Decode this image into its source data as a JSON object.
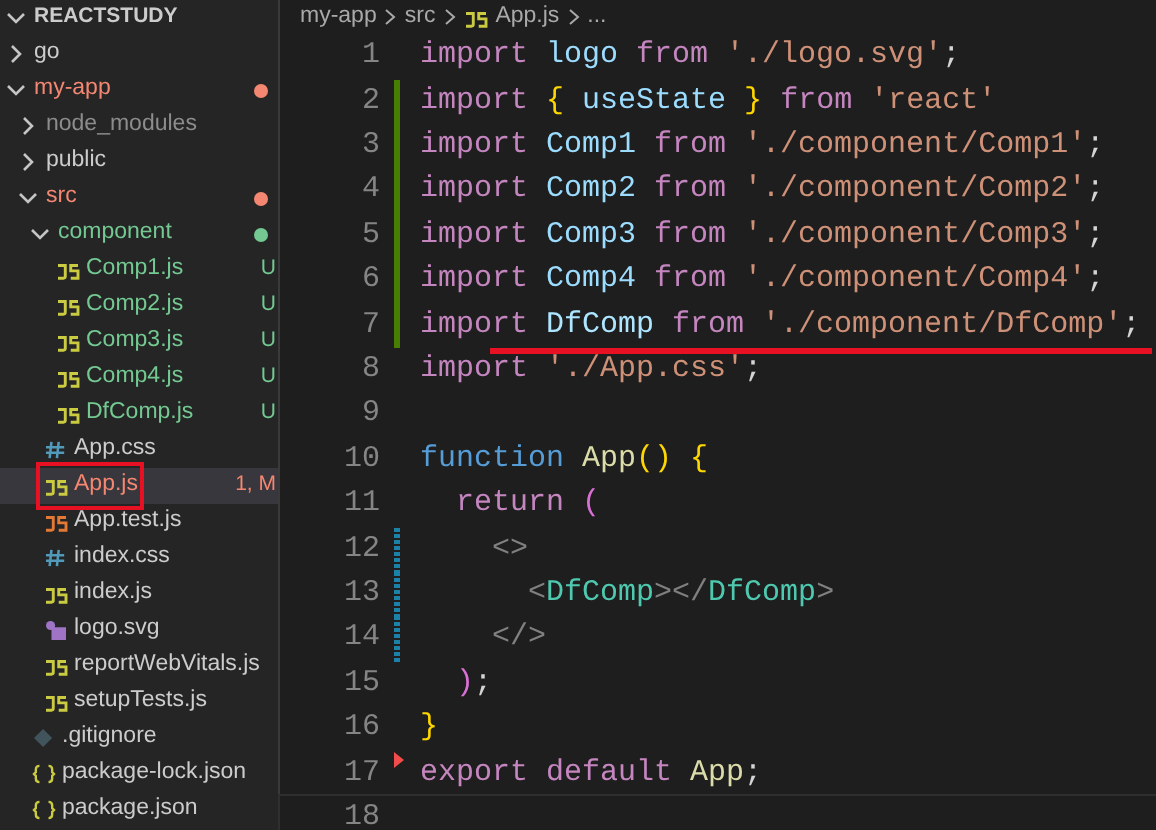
{
  "explorer": {
    "title": "REACTSTUDY",
    "expanded": true,
    "items": [
      {
        "label": "go",
        "kind": "folder",
        "expanded": false,
        "color": "#cccccc",
        "dot": false,
        "selected": false,
        "boxed": false
      },
      {
        "label": "my-app",
        "kind": "folder",
        "expanded": true,
        "color": "#f48771",
        "dot": true,
        "selected": false,
        "boxed": false,
        "children": [
          {
            "label": "node_modules",
            "kind": "folder",
            "expanded": false,
            "color": "#8c8c8c",
            "dot": false,
            "selected": false,
            "boxed": false
          },
          {
            "label": "public",
            "kind": "folder",
            "expanded": false,
            "color": "#cccccc",
            "dot": false,
            "selected": false,
            "boxed": false
          },
          {
            "label": "src",
            "kind": "folder",
            "expanded": true,
            "color": "#f48771",
            "dot": true,
            "selected": false,
            "boxed": false,
            "children": [
              {
                "label": "component",
                "kind": "folder",
                "expanded": true,
                "color": "#73c991",
                "dot": true,
                "selected": false,
                "boxed": false,
                "children": [
                  {
                    "label": "Comp1.js",
                    "kind": "js",
                    "color": "#73c991",
                    "badge": "U",
                    "selected": false,
                    "boxed": false
                  },
                  {
                    "label": "Comp2.js",
                    "kind": "js",
                    "color": "#73c991",
                    "badge": "U",
                    "selected": false,
                    "boxed": false
                  },
                  {
                    "label": "Comp3.js",
                    "kind": "js",
                    "color": "#73c991",
                    "badge": "U",
                    "selected": false,
                    "boxed": false
                  },
                  {
                    "label": "Comp4.js",
                    "kind": "js",
                    "color": "#73c991",
                    "badge": "U",
                    "selected": false,
                    "boxed": false
                  },
                  {
                    "label": "DfComp.js",
                    "kind": "js",
                    "color": "#73c991",
                    "badge": "U",
                    "selected": false,
                    "boxed": false
                  }
                ]
              },
              {
                "label": "App.css",
                "kind": "css",
                "color": "#cccccc",
                "selected": false,
                "boxed": false
              },
              {
                "label": "App.js",
                "kind": "js",
                "color": "#f48771",
                "badge": "1, M",
                "selected": true,
                "boxed": true
              },
              {
                "label": "App.test.js",
                "kind": "test",
                "color": "#cccccc",
                "selected": false,
                "boxed": false
              },
              {
                "label": "index.css",
                "kind": "css",
                "color": "#cccccc",
                "selected": false,
                "boxed": false
              },
              {
                "label": "index.js",
                "kind": "js",
                "color": "#cccccc",
                "selected": false,
                "boxed": false
              },
              {
                "label": "logo.svg",
                "kind": "svg",
                "color": "#cccccc",
                "selected": false,
                "boxed": false
              },
              {
                "label": "reportWebVitals.js",
                "kind": "js",
                "color": "#cccccc",
                "selected": false,
                "boxed": false
              },
              {
                "label": "setupTests.js",
                "kind": "js",
                "color": "#cccccc",
                "selected": false,
                "boxed": false
              }
            ]
          },
          {
            "label": ".gitignore",
            "kind": "git",
            "color": "#cccccc",
            "selected": false,
            "boxed": false
          },
          {
            "label": "package-lock.json",
            "kind": "json",
            "color": "#cccccc",
            "selected": false,
            "boxed": false
          },
          {
            "label": "package.json",
            "kind": "json",
            "color": "#cccccc",
            "selected": false,
            "boxed": false
          }
        ]
      }
    ]
  },
  "breadcrumbs": [
    {
      "label": "my-app",
      "kind": "folder"
    },
    {
      "label": "src",
      "kind": "folder"
    },
    {
      "label": "App.js",
      "kind": "js"
    },
    {
      "label": "...",
      "kind": "more"
    }
  ],
  "editor": {
    "lines": [
      {
        "number": "1",
        "kind": "plain",
        "current": false,
        "underlined": false,
        "tokens": [
          {
            "kind": "keyword",
            "text": "import "
          },
          {
            "kind": "variable",
            "text": "logo"
          },
          {
            "kind": "keyword",
            "text": " from "
          },
          {
            "kind": "string",
            "text": "'./logo.svg'"
          },
          {
            "kind": "plain",
            "text": ";"
          }
        ]
      },
      {
        "number": "2",
        "kind": "added",
        "current": false,
        "underlined": false,
        "tokens": [
          {
            "kind": "keyword",
            "text": "import "
          },
          {
            "kind": "bracket",
            "text": "{"
          },
          {
            "kind": "variable",
            "text": " useState "
          },
          {
            "kind": "bracket",
            "text": "}"
          },
          {
            "kind": "keyword",
            "text": " from "
          },
          {
            "kind": "string",
            "text": "'react'"
          }
        ]
      },
      {
        "number": "3",
        "kind": "added",
        "current": false,
        "underlined": false,
        "tokens": [
          {
            "kind": "keyword",
            "text": "import "
          },
          {
            "kind": "variable",
            "text": "Comp1"
          },
          {
            "kind": "keyword",
            "text": " from "
          },
          {
            "kind": "string",
            "text": "'./component/Comp1'"
          },
          {
            "kind": "plain",
            "text": ";"
          }
        ]
      },
      {
        "number": "4",
        "kind": "added",
        "current": false,
        "underlined": false,
        "tokens": [
          {
            "kind": "keyword",
            "text": "import "
          },
          {
            "kind": "variable",
            "text": "Comp2"
          },
          {
            "kind": "keyword",
            "text": " from "
          },
          {
            "kind": "string",
            "text": "'./component/Comp2'"
          },
          {
            "kind": "plain",
            "text": ";"
          }
        ]
      },
      {
        "number": "5",
        "kind": "added",
        "current": false,
        "underlined": false,
        "tokens": [
          {
            "kind": "keyword",
            "text": "import "
          },
          {
            "kind": "variable",
            "text": "Comp3"
          },
          {
            "kind": "keyword",
            "text": " from "
          },
          {
            "kind": "string",
            "text": "'./component/Comp3'"
          },
          {
            "kind": "plain",
            "text": ";"
          }
        ]
      },
      {
        "number": "6",
        "kind": "added",
        "current": false,
        "underlined": false,
        "tokens": [
          {
            "kind": "keyword",
            "text": "import "
          },
          {
            "kind": "variable",
            "text": "Comp4"
          },
          {
            "kind": "keyword",
            "text": " from "
          },
          {
            "kind": "string",
            "text": "'./component/Comp4'"
          },
          {
            "kind": "plain",
            "text": ";"
          }
        ]
      },
      {
        "number": "7",
        "kind": "added",
        "current": false,
        "underlined": true,
        "tokens": [
          {
            "kind": "keyword",
            "text": "import "
          },
          {
            "kind": "used",
            "text": "DfComp"
          },
          {
            "kind": "keyword",
            "text": " from "
          },
          {
            "kind": "string",
            "text": "'./component/DfComp'"
          },
          {
            "kind": "plain",
            "text": ";"
          }
        ]
      },
      {
        "number": "8",
        "kind": "plain",
        "current": false,
        "underlined": false,
        "tokens": [
          {
            "kind": "keyword",
            "text": "import "
          },
          {
            "kind": "string",
            "text": "'./App.css'"
          },
          {
            "kind": "plain",
            "text": ";"
          }
        ]
      },
      {
        "number": "9",
        "kind": "plain",
        "current": false,
        "underlined": false
      },
      {
        "number": "10",
        "kind": "plain",
        "current": false,
        "underlined": false,
        "tokens": [
          {
            "kind": "storage",
            "text": "function "
          },
          {
            "kind": "func",
            "text": "App"
          },
          {
            "kind": "bracket",
            "text": "() {"
          }
        ]
      },
      {
        "number": "11",
        "kind": "plain",
        "current": false,
        "underlined": false,
        "tokens": [
          {
            "kind": "keyword",
            "text": "  return "
          },
          {
            "kind": "paren",
            "text": "("
          }
        ]
      },
      {
        "number": "12",
        "kind": "modified",
        "current": false,
        "underlined": false,
        "tokens": [
          {
            "kind": "tag",
            "text": "    <>"
          }
        ]
      },
      {
        "number": "13",
        "kind": "modified",
        "current": false,
        "underlined": false,
        "tokens": [
          {
            "kind": "tag",
            "text": "      <"
          },
          {
            "kind": "component",
            "text": "DfComp"
          },
          {
            "kind": "tag",
            "text": "></"
          },
          {
            "kind": "component",
            "text": "DfComp"
          },
          {
            "kind": "tag",
            "text": ">"
          }
        ]
      },
      {
        "number": "14",
        "kind": "modified",
        "current": false,
        "underlined": false,
        "tokens": [
          {
            "kind": "tag",
            "text": "    </>"
          }
        ]
      },
      {
        "number": "15",
        "kind": "plain",
        "current": false,
        "underlined": false,
        "tokens": [
          {
            "kind": "paren",
            "text": "  )"
          },
          {
            "kind": "plain",
            "text": ";"
          }
        ]
      },
      {
        "number": "16",
        "kind": "plain",
        "current": false,
        "underlined": false,
        "tokens": [
          {
            "kind": "bracket",
            "text": "}"
          }
        ]
      },
      {
        "number": "17",
        "kind": "deleted",
        "current": false,
        "underlined": false,
        "tokens": [
          {
            "kind": "keyword",
            "text": "export default "
          },
          {
            "kind": "func",
            "text": "App"
          },
          {
            "kind": "plain",
            "text": ";"
          }
        ]
      },
      {
        "number": "18",
        "kind": "plain",
        "current": true,
        "underlined": false
      }
    ]
  }
}
